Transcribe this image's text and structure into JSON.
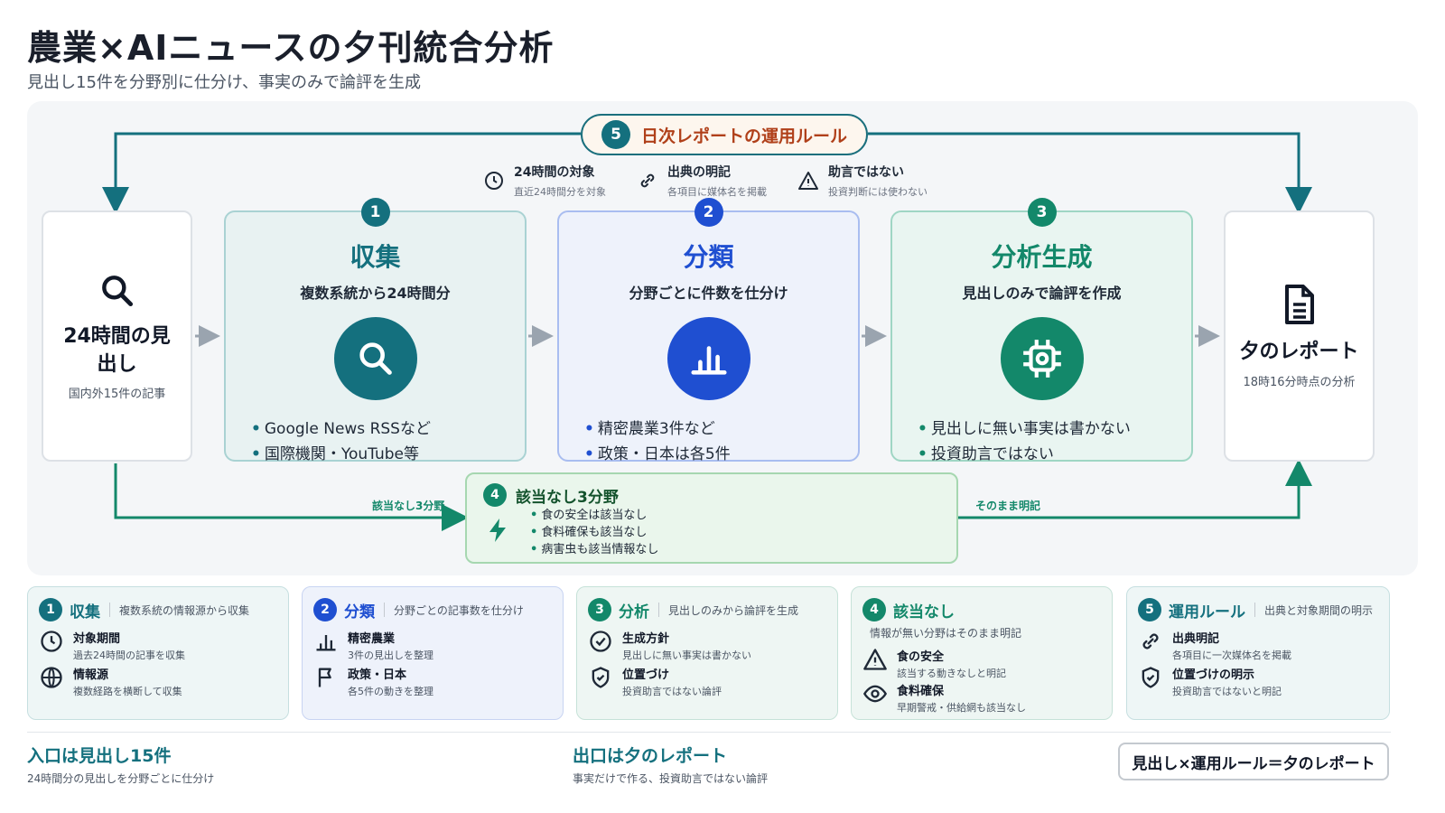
{
  "title": "農業×AIニュースの夕刊統合分析",
  "subtitle": "見出し15件を分野別に仕分け、事実のみで論評を生成",
  "rule": {
    "num": "5",
    "label": "日次レポートの運用ルール",
    "items": [
      {
        "icon": "clock-icon",
        "title": "24時間の対象",
        "desc": "直近24時間分を対象"
      },
      {
        "icon": "link-icon",
        "title": "出典の明記",
        "desc": "各項目に媒体名を掲載"
      },
      {
        "icon": "warning-icon",
        "title": "助言ではない",
        "desc": "投資判断には使わない"
      }
    ]
  },
  "input": {
    "icon": "search-icon",
    "title": "24時間の見出し",
    "desc": "国内外15件の記事"
  },
  "output": {
    "icon": "document-icon",
    "title": "夕のレポート",
    "desc": "18時16分時点の分析"
  },
  "stages": [
    {
      "num": "1",
      "title": "収集",
      "sub": "複数系統から24時間分",
      "icon": "search-icon",
      "bullets": [
        "Google News RSSなど",
        "国際機関・YouTube等"
      ]
    },
    {
      "num": "2",
      "title": "分類",
      "sub": "分野ごとに件数を仕分け",
      "icon": "bar-chart-icon",
      "bullets": [
        "精密農業3件など",
        "政策・日本は各5件"
      ]
    },
    {
      "num": "3",
      "title": "分析生成",
      "sub": "見出しのみで論評を作成",
      "icon": "chip-icon",
      "bullets": [
        "見出しに無い事実は書かない",
        "投資助言ではない"
      ]
    }
  ],
  "na": {
    "num": "4",
    "label": "該当なし3分野",
    "icon": "bolt-icon",
    "items": [
      "食の安全は該当なし",
      "食料確保も該当なし",
      "病害虫も該当情報なし"
    ],
    "in_label": "該当なし3分野",
    "out_label": "そのまま明記"
  },
  "legend": [
    {
      "num": "1",
      "title": "収集",
      "desc": "複数系統の情報源から収集",
      "rows": [
        {
          "icon": "clock-icon",
          "t1": "対象期間",
          "t2": "過去24時間の記事を収集"
        },
        {
          "icon": "globe-icon",
          "t1": "情報源",
          "t2": "複数経路を横断して収集"
        }
      ]
    },
    {
      "num": "2",
      "title": "分類",
      "desc": "分野ごとの記事数を仕分け",
      "rows": [
        {
          "icon": "bar-chart-icon",
          "t1": "精密農業",
          "t2": "3件の見出しを整理"
        },
        {
          "icon": "flag-icon",
          "t1": "政策・日本",
          "t2": "各5件の動きを整理"
        }
      ]
    },
    {
      "num": "3",
      "title": "分析",
      "desc": "見出しのみから論評を生成",
      "rows": [
        {
          "icon": "check-circle-icon",
          "t1": "生成方針",
          "t2": "見出しに無い事実は書かない"
        },
        {
          "icon": "shield-check-icon",
          "t1": "位置づけ",
          "t2": "投資助言ではない論評"
        }
      ]
    },
    {
      "num": "4",
      "title": "該当なし",
      "desc": "情報が無い分野はそのまま明記",
      "rows": [
        {
          "icon": "warning-icon",
          "t1": "食の安全",
          "t2": "該当する動きなしと明記"
        },
        {
          "icon": "eye-icon",
          "t1": "食料確保",
          "t2": "早期警戒・供給網も該当なし"
        }
      ]
    },
    {
      "num": "5",
      "title": "運用ルール",
      "desc": "出典と対象期間の明示",
      "rows": [
        {
          "icon": "link-icon",
          "t1": "出典明記",
          "t2": "各項目に一次媒体名を掲載"
        },
        {
          "icon": "shield-check-icon",
          "t1": "位置づけの明示",
          "t2": "投資助言ではないと明記"
        }
      ]
    }
  ],
  "footer": {
    "left_title": "入口は見出し15件",
    "left_desc": "24時間分の見出しを分野ごとに仕分け",
    "mid_title": "出口は夕のレポート",
    "mid_desc": "事実だけで作る、投資助言ではない論評",
    "formula": "見出し×運用ルール＝夕のレポート"
  },
  "colors": {
    "teal": "#14707e",
    "blue": "#1f4fd1",
    "green": "#13886a",
    "rule_text": "#b0401a"
  }
}
